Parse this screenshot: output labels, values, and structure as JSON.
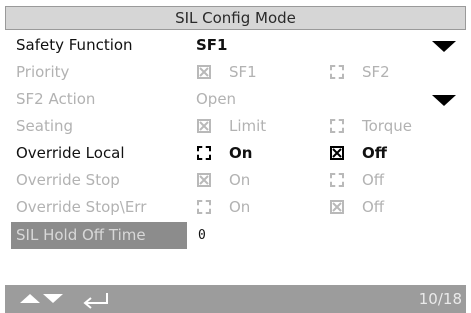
{
  "header": {
    "title": "SIL Config Mode"
  },
  "rows": {
    "safety_function": {
      "label": "Safety Function",
      "value": "SF1"
    },
    "priority": {
      "label": "Priority",
      "opt1": "SF1",
      "opt2": "SF2"
    },
    "sf2_action": {
      "label": "SF2 Action",
      "value": "Open"
    },
    "seating": {
      "label": "Seating",
      "opt1": "Limit",
      "opt2": "Torque"
    },
    "override_local": {
      "label": "Override Local",
      "opt1": "On",
      "opt2": "Off"
    },
    "override_stop": {
      "label": "Override Stop",
      "opt1": "On",
      "opt2": "Off"
    },
    "override_stop_err": {
      "label": "Override Stop\\Err",
      "opt1": "On",
      "opt2": "Off"
    },
    "sil_hold_off_time": {
      "label": "SIL Hold Off Time",
      "value": "0"
    }
  },
  "footer": {
    "page": "10/18"
  },
  "icons": {
    "nav_up": "arrow-up-icon",
    "nav_down": "arrow-down-icon",
    "enter": "enter-return-icon",
    "dropdown": "dropdown-arrow-icon"
  },
  "colors": {
    "active_text": "#111111",
    "disabled_text": "#b2b2b2",
    "selected_row_bg": "#8c8c8c",
    "footer_bg": "#9c9c9c",
    "title_bg": "#d6d6d6"
  }
}
